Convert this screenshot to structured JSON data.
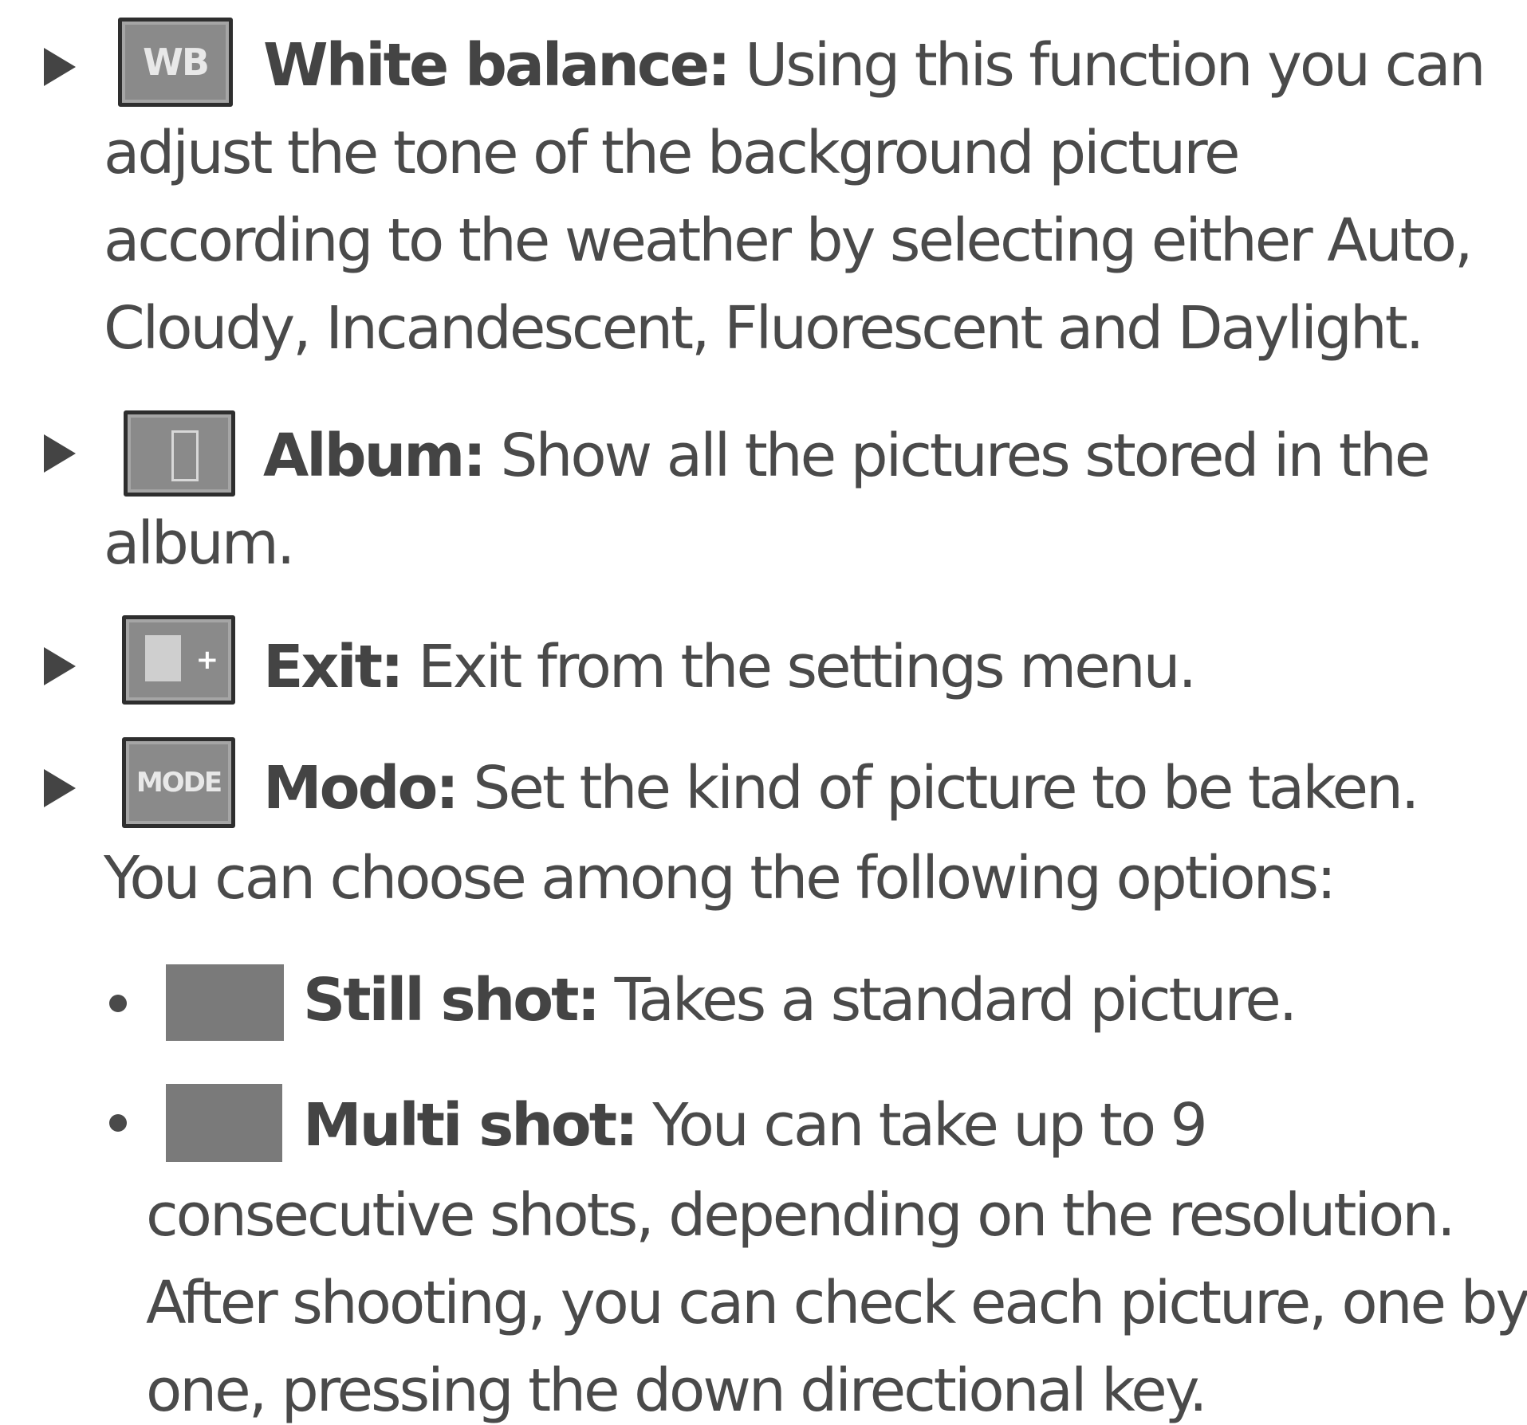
{
  "items": [
    {
      "icon": "wb-icon",
      "icon_text": "WB",
      "label": "White balance:",
      "lines": [
        "Using this function you can",
        "adjust the tone of the background picture",
        "according to the weather by selecting either Auto,",
        "Cloudy, Incandescent, Fluorescent and Daylight."
      ]
    },
    {
      "icon": "album-icon",
      "label": "Album:",
      "lines": [
        "Show all the pictures stored in the",
        "album."
      ]
    },
    {
      "icon": "exit-icon",
      "label": "Exit:",
      "lines": [
        "Exit from the settings menu."
      ]
    },
    {
      "icon": "mode-icon",
      "icon_text": "MODE",
      "label": "Modo:",
      "lines": [
        "Set the kind of picture to be taken.",
        "You can choose among the following options:"
      ]
    }
  ],
  "sub_items": [
    {
      "label": "Still shot:",
      "lines": [
        "Takes a standard picture."
      ]
    },
    {
      "label": "Multi shot:",
      "lines": [
        "You can take up to 9",
        "consecutive shots, depending on the resolution.",
        "After shooting, you can check each picture, one by",
        "one, pressing the down directional key."
      ]
    }
  ]
}
